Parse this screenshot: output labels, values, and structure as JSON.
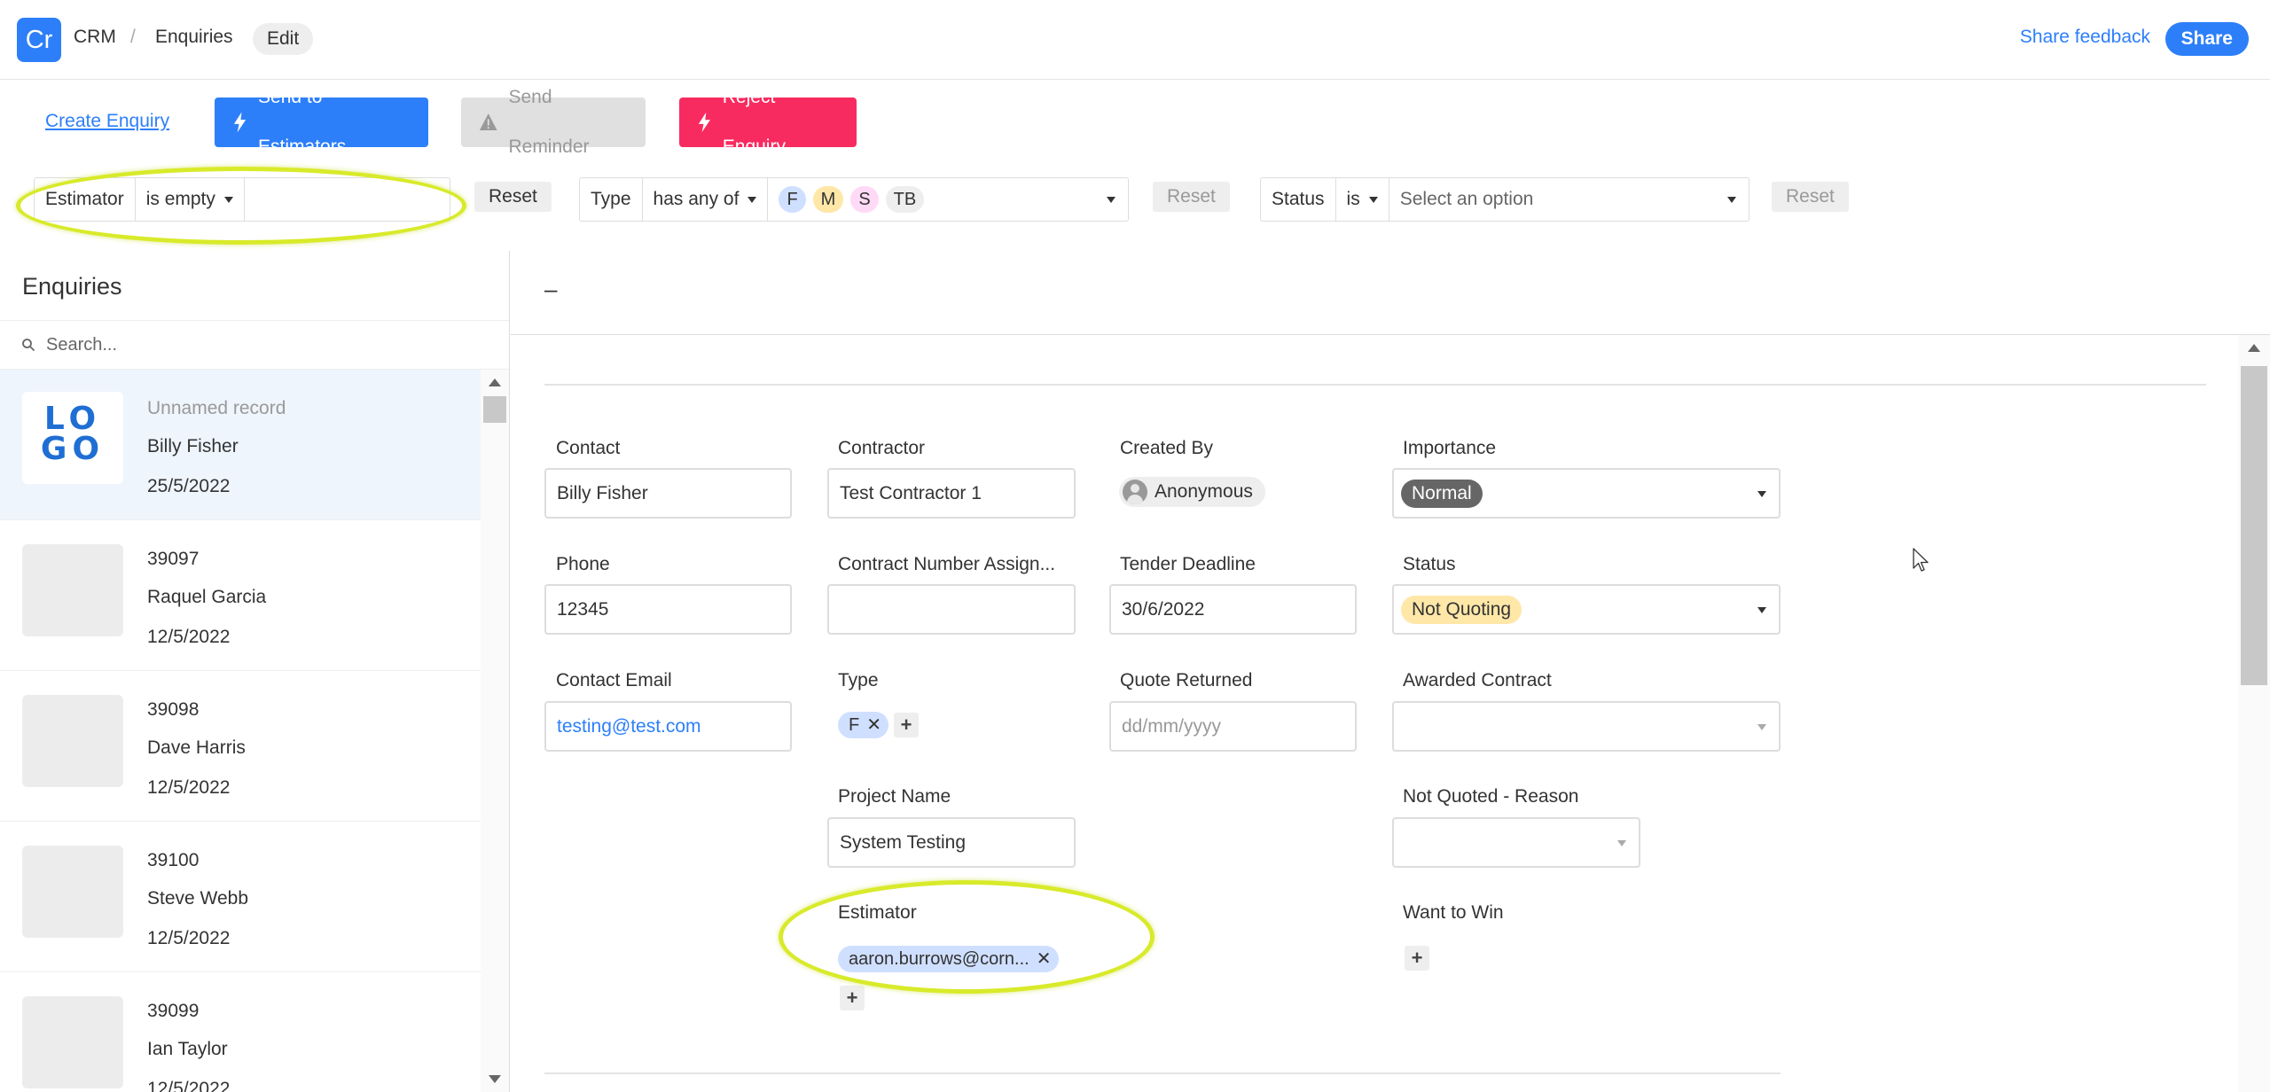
{
  "header": {
    "app_icon_text": "Cr",
    "breadcrumb": [
      "CRM",
      "Enquiries"
    ],
    "breadcrumb_separator": "/",
    "edit_label": "Edit",
    "share_feedback": "Share feedback",
    "share": "Share"
  },
  "actions": {
    "create": "Create Enquiry",
    "send": "Send to Estimators",
    "remind": "Send Reminder",
    "reject": "Reject Enquiry"
  },
  "filters": {
    "estimator": {
      "field": "Estimator",
      "operator": "is empty",
      "value": "",
      "reset": "Reset"
    },
    "type": {
      "field": "Type",
      "operator": "has any of",
      "tags": [
        "F",
        "M",
        "S",
        "TB"
      ],
      "reset": "Reset"
    },
    "status": {
      "field": "Status",
      "operator": "is",
      "placeholder": "Select an option",
      "reset": "Reset"
    }
  },
  "list": {
    "title": "Enquiries",
    "search_placeholder": "Search...",
    "logo_text": "LOGO",
    "records": [
      {
        "line1": "Unnamed record",
        "line2": "Billy Fisher",
        "line3": "25/5/2022"
      },
      {
        "line1": "39097",
        "line2": "Raquel Garcia",
        "line3": "12/5/2022"
      },
      {
        "line1": "39098",
        "line2": "Dave Harris",
        "line3": "12/5/2022"
      },
      {
        "line1": "39100",
        "line2": "Steve Webb",
        "line3": "12/5/2022"
      },
      {
        "line1": "39099",
        "line2": "Ian Taylor",
        "line3": "12/5/2022"
      }
    ]
  },
  "detail": {
    "title": "–",
    "contact": {
      "label": "Contact",
      "value": "Billy Fisher"
    },
    "contractor": {
      "label": "Contractor",
      "value": "Test Contractor 1"
    },
    "created_by": {
      "label": "Created By",
      "value": "Anonymous"
    },
    "importance": {
      "label": "Importance",
      "value": "Normal"
    },
    "phone": {
      "label": "Phone",
      "value": "12345"
    },
    "contract_number": {
      "label": "Contract Number Assign...",
      "value": ""
    },
    "tender_deadline": {
      "label": "Tender Deadline",
      "value": "30/6/2022"
    },
    "status": {
      "label": "Status",
      "value": "Not Quoting"
    },
    "contact_email": {
      "label": "Contact Email",
      "value": "testing@test.com"
    },
    "type": {
      "label": "Type",
      "value": "F"
    },
    "quote_returned": {
      "label": "Quote Returned",
      "placeholder": "dd/mm/yyyy"
    },
    "awarded_contract": {
      "label": "Awarded Contract",
      "value": ""
    },
    "project_name": {
      "label": "Project Name",
      "value": "System Testing"
    },
    "not_quoted_reason": {
      "label": "Not Quoted - Reason",
      "value": ""
    },
    "estimator": {
      "label": "Estimator",
      "value": "aaron.burrows@corn..."
    },
    "want_to_win": {
      "label": "Want to Win"
    }
  },
  "colors": {
    "primary": "#2d7ff9",
    "danger": "#f82b60",
    "highlight": "#d8ea2a",
    "tag_f": "#cfdfff",
    "tag_m": "#ffe7a8",
    "tag_s": "#ffdaf6",
    "tag_tb": "#eeeeee"
  }
}
